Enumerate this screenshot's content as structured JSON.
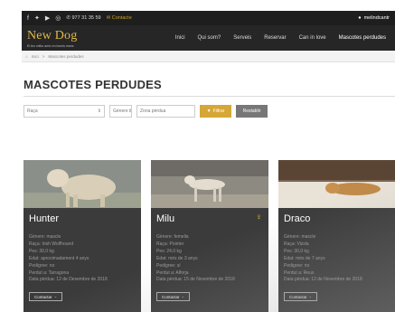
{
  "topbar": {
    "phone": "977 31 35 59",
    "contact": "Contacte",
    "user": "melindcantr",
    "icons": [
      "facebook-icon",
      "twitter-icon",
      "youtube-icon",
      "instagram-icon"
    ]
  },
  "brand": {
    "name": "New Dog",
    "tagline": "El teu millor amic en bones mans"
  },
  "nav": {
    "items": [
      {
        "label": "Inici"
      },
      {
        "label": "Qui som?"
      },
      {
        "label": "Serveis"
      },
      {
        "label": "Reservar"
      },
      {
        "label": "Can in love"
      },
      {
        "label": "Mascotes perdudes"
      }
    ]
  },
  "breadcrumb": {
    "home": "Inici",
    "separator": ">",
    "current": "Mascotes perdudes"
  },
  "page": {
    "title": "MASCOTES PERDUDES"
  },
  "filters": {
    "race_placeholder": "Raça",
    "gender_placeholder": "Gènere",
    "zone_placeholder": "Zona pèrdua",
    "filter_label": "Filtrar",
    "reset_label": "Restablir"
  },
  "cards": [
    {
      "name": "Hunter",
      "badge": "",
      "info": [
        "Gènere: mascle",
        "Raça: Irish Wolfhound",
        "Pes: 30,0 kg",
        "Edat: aproximadament 4 anys",
        "Pedigree: no",
        "Perdut a: Tarragona",
        "Data pèrdua: 12 de Desembre de 2018"
      ],
      "contact": "Contactar"
    },
    {
      "name": "Milu",
      "badge": "♀",
      "info": [
        "Gènere: femella",
        "Raça: Pointer",
        "Pes: 24,0 kg",
        "Edat: més de 3 anys",
        "Pedigree: sí",
        "Perdut a: Alforja",
        "Data pèrdua: 15 de Novembre de 2018"
      ],
      "contact": "Contactar"
    },
    {
      "name": "Draco",
      "badge": "",
      "info": [
        "Gènere: mascle",
        "Raça: Vizsla",
        "Pes: 30,0 kg",
        "Edat: més de 7 anys",
        "Pedigree: no",
        "Perdut a: Reus",
        "Data pèrdua: 12 de Novembre de 2018"
      ],
      "contact": "Contactar"
    }
  ],
  "colors": {
    "accent": "#d6a637",
    "dark": "#262626",
    "card": "#3b3b3b"
  }
}
